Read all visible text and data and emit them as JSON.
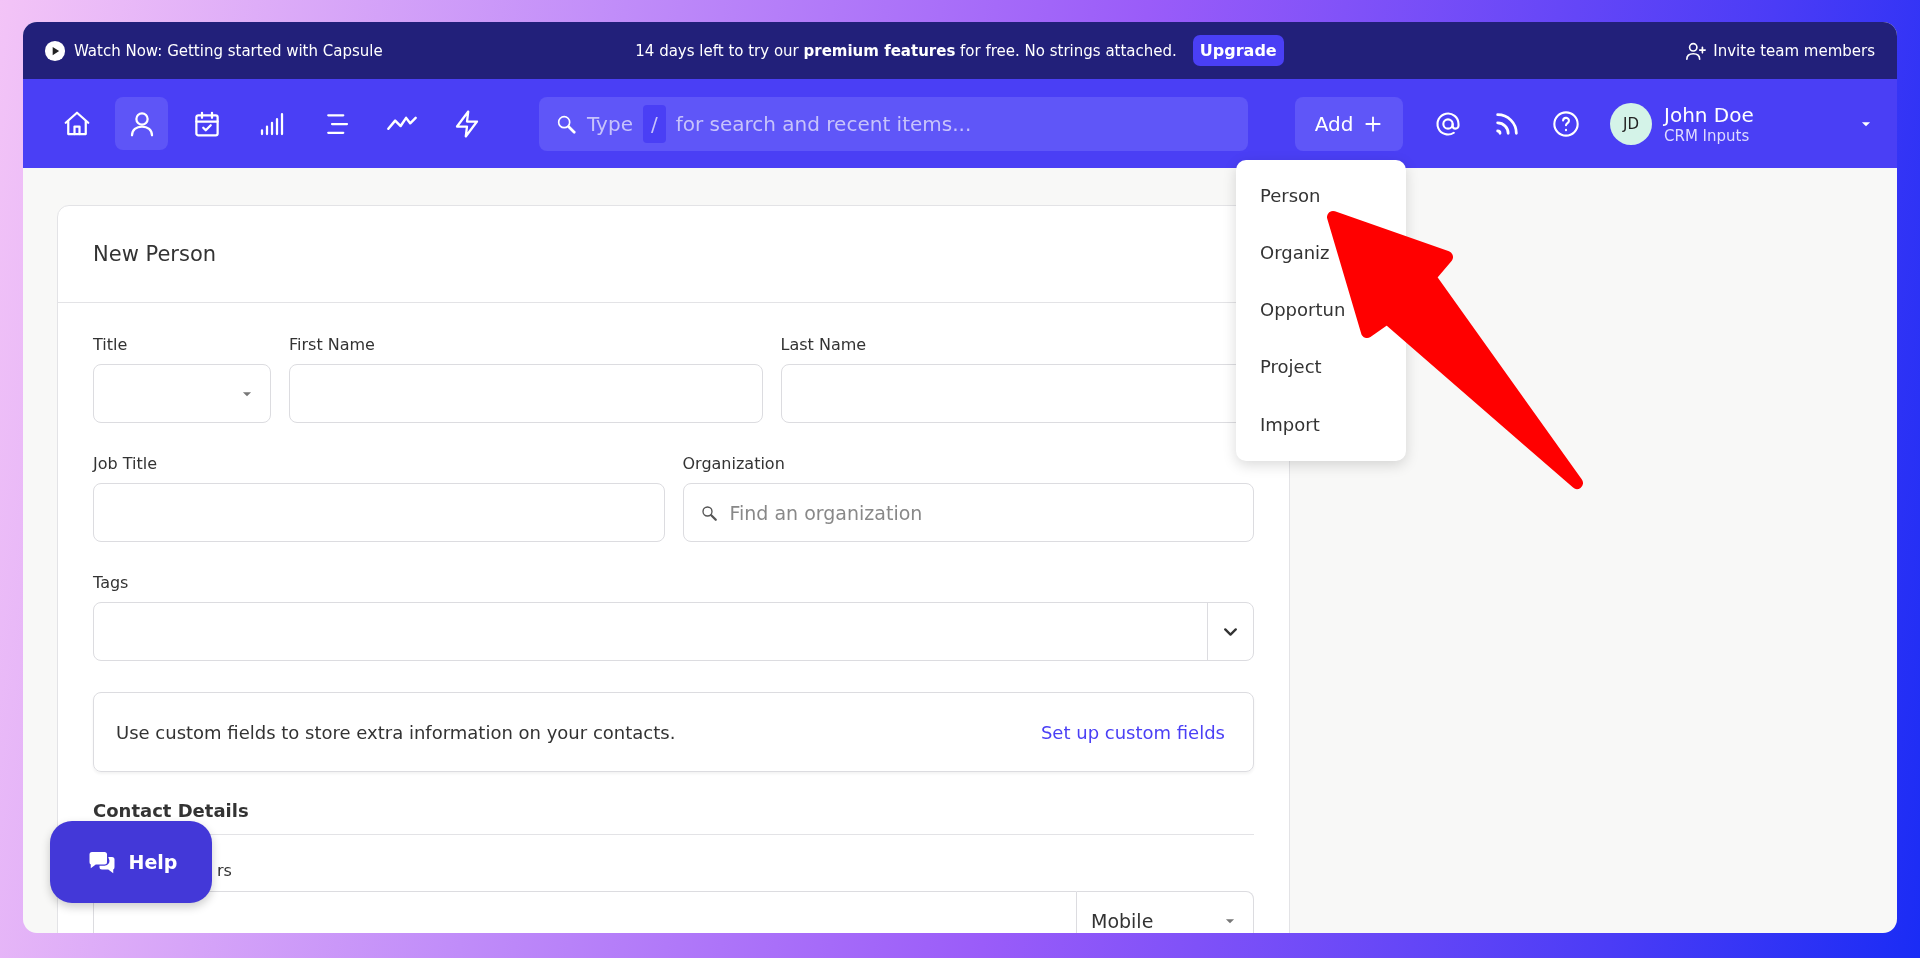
{
  "banner": {
    "video_link": "Watch Now: Getting started with Capsule",
    "message": "14 days left to try our **premium features** for free. No strings attached.",
    "upgrade_button": "Upgrade",
    "invite_link": "Invite team members"
  },
  "nav": {
    "items": [
      {
        "kind": "home",
        "selected": false
      },
      {
        "kind": "person",
        "selected": true
      },
      {
        "kind": "calendar",
        "selected": false
      },
      {
        "kind": "bars",
        "selected": false
      },
      {
        "kind": "list",
        "selected": false
      },
      {
        "kind": "trend",
        "selected": false
      },
      {
        "kind": "bolt",
        "selected": false
      }
    ]
  },
  "search": {
    "placeholder_before": "Type",
    "shortcut_key": "/",
    "placeholder_after": "for search and recent items..."
  },
  "add_button": "Add",
  "user": {
    "initials": "JD",
    "name": "John Doe",
    "account": "CRM Inputs"
  },
  "add_menu": {
    "items": [
      {
        "label": "Person"
      },
      {
        "label": "Organiz"
      },
      {
        "label": "Opportun"
      },
      {
        "label": "Project"
      }
    ],
    "footer_items": [
      {
        "label": "Import"
      }
    ]
  },
  "form": {
    "title": "New Person",
    "title_field": {
      "label": "Title",
      "kind": "select"
    },
    "first_name_field": {
      "label": "First Name",
      "kind": "text"
    },
    "last_name_field": {
      "label": "Last Name",
      "kind": "text"
    },
    "job_title_field": {
      "label": "Job Title",
      "kind": "text"
    },
    "organization_field": {
      "label": "Organization",
      "kind": "search",
      "placeholder": "Find an organization"
    },
    "tags_field": {
      "label": "Tags",
      "kind": "tags"
    },
    "custom_fields_note": {
      "text": "Use custom fields to store extra information on your contacts.",
      "link": "Set up custom fields"
    },
    "section_title": "Contact Details",
    "phone": {
      "label": "rs",
      "type_value": "Mobile"
    }
  },
  "help_button": "Help"
}
